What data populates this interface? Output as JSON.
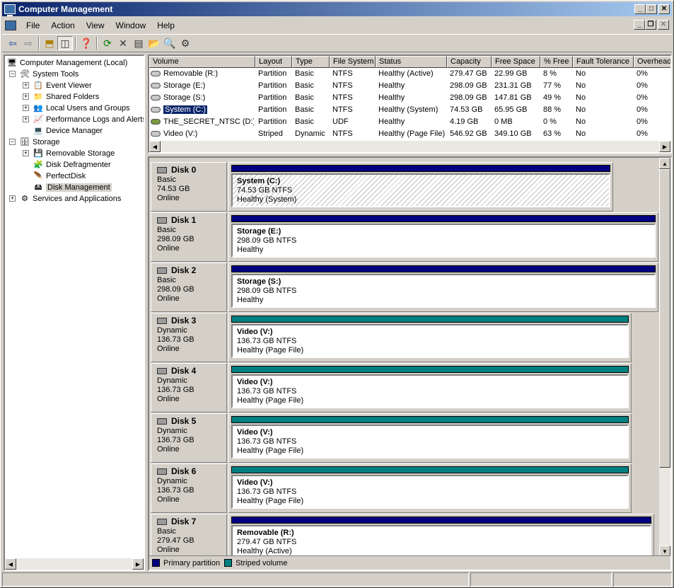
{
  "window": {
    "title": "Computer Management"
  },
  "menu": [
    "File",
    "Action",
    "View",
    "Window",
    "Help"
  ],
  "tree": {
    "root": "Computer Management (Local)",
    "system_tools": "System Tools",
    "event_viewer": "Event Viewer",
    "shared_folders": "Shared Folders",
    "local_users": "Local Users and Groups",
    "perf_logs": "Performance Logs and Alerts",
    "device_manager": "Device Manager",
    "storage": "Storage",
    "removable_storage": "Removable Storage",
    "disk_defrag": "Disk Defragmenter",
    "perfectdisk": "PerfectDisk",
    "disk_mgmt": "Disk Management",
    "services": "Services and Applications"
  },
  "volume_list": {
    "columns": [
      "Volume",
      "Layout",
      "Type",
      "File System",
      "Status",
      "Capacity",
      "Free Space",
      "% Free",
      "Fault Tolerance",
      "Overhead"
    ],
    "rows": [
      [
        "Removable (R:)",
        "Partition",
        "Basic",
        "NTFS",
        "Healthy (Active)",
        "279.47 GB",
        "22.99 GB",
        "8 %",
        "No",
        "0%"
      ],
      [
        "Storage (E:)",
        "Partition",
        "Basic",
        "NTFS",
        "Healthy",
        "298.09 GB",
        "231.31 GB",
        "77 %",
        "No",
        "0%"
      ],
      [
        "Storage (S:)",
        "Partition",
        "Basic",
        "NTFS",
        "Healthy",
        "298.09 GB",
        "147.81 GB",
        "49 %",
        "No",
        "0%"
      ],
      [
        "System (C:)",
        "Partition",
        "Basic",
        "NTFS",
        "Healthy (System)",
        "74.53 GB",
        "65.95 GB",
        "88 %",
        "No",
        "0%"
      ],
      [
        "THE_SECRET_NTSC (D:)",
        "Partition",
        "Basic",
        "UDF",
        "Healthy",
        "4.19 GB",
        "0 MB",
        "0 %",
        "No",
        "0%"
      ],
      [
        "Video (V:)",
        "Striped",
        "Dynamic",
        "NTFS",
        "Healthy (Page File)",
        "546.92 GB",
        "349.10 GB",
        "63 %",
        "No",
        "0%"
      ]
    ]
  },
  "disks": [
    {
      "name": "Disk 0",
      "type": "Basic",
      "size": "74.53 GB",
      "state": "Online",
      "vol": "System  (C:)",
      "detail": "74.53 GB NTFS",
      "status": "Healthy (System)"
    },
    {
      "name": "Disk 1",
      "type": "Basic",
      "size": "298.09 GB",
      "state": "Online",
      "vol": "Storage  (E:)",
      "detail": "298.09 GB NTFS",
      "status": "Healthy"
    },
    {
      "name": "Disk 2",
      "type": "Basic",
      "size": "298.09 GB",
      "state": "Online",
      "vol": "Storage  (S:)",
      "detail": "298.09 GB NTFS",
      "status": "Healthy"
    },
    {
      "name": "Disk 3",
      "type": "Dynamic",
      "size": "136.73 GB",
      "state": "Online",
      "vol": "Video  (V:)",
      "detail": "136.73 GB NTFS",
      "status": "Healthy (Page File)"
    },
    {
      "name": "Disk 4",
      "type": "Dynamic",
      "size": "136.73 GB",
      "state": "Online",
      "vol": "Video  (V:)",
      "detail": "136.73 GB NTFS",
      "status": "Healthy (Page File)"
    },
    {
      "name": "Disk 5",
      "type": "Dynamic",
      "size": "136.73 GB",
      "state": "Online",
      "vol": "Video  (V:)",
      "detail": "136.73 GB NTFS",
      "status": "Healthy (Page File)"
    },
    {
      "name": "Disk 6",
      "type": "Dynamic",
      "size": "136.73 GB",
      "state": "Online",
      "vol": "Video  (V:)",
      "detail": "136.73 GB NTFS",
      "status": "Healthy (Page File)"
    },
    {
      "name": "Disk 7",
      "type": "Basic",
      "size": "279.47 GB",
      "state": "Online",
      "vol": "Removable  (R:)",
      "detail": "279.47 GB NTFS",
      "status": "Healthy (Active)"
    }
  ],
  "legend": {
    "primary": "Primary partition",
    "striped": "Striped volume"
  },
  "colors": {
    "primary": "#000080",
    "striped": "#008080",
    "title_start": "#0a246a",
    "title_end": "#a6caf0"
  }
}
